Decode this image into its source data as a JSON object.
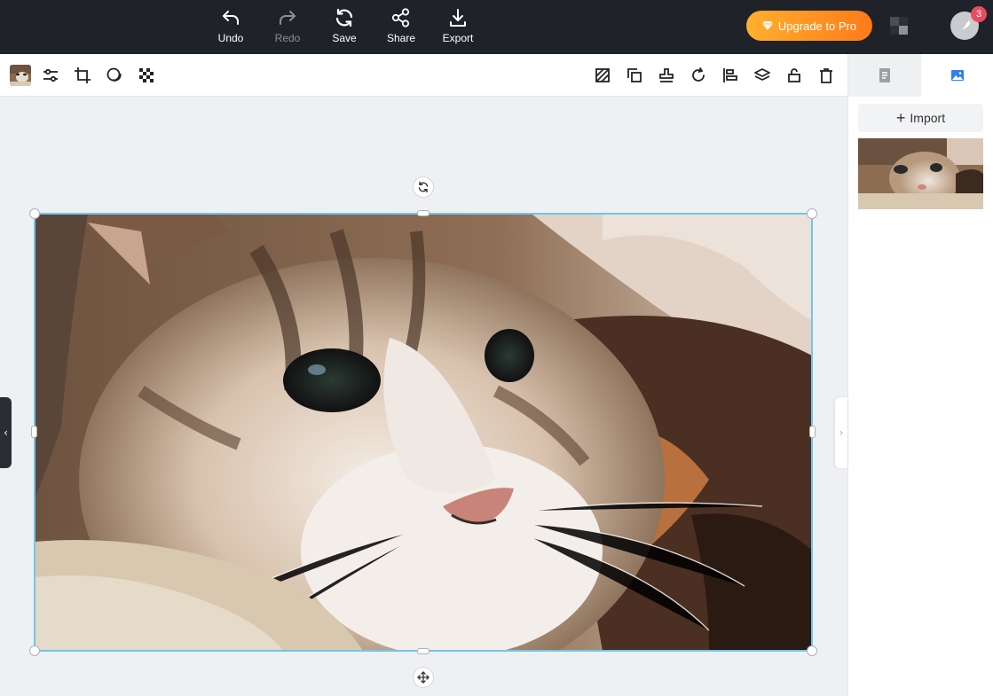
{
  "topbar": {
    "undo_label": "Undo",
    "redo_label": "Redo",
    "save_label": "Save",
    "share_label": "Share",
    "export_label": "Export",
    "upgrade_label": "Upgrade to Pro",
    "notification_count": "3"
  },
  "panel": {
    "import_label": "Import"
  },
  "colors": {
    "topbar_bg": "#1f2329",
    "accent": "#2f80ed",
    "selection": "#6cc7ef",
    "upgrade_start": "#ffb02e",
    "upgrade_end": "#ff7a1a",
    "badge": "#ea4c5f"
  },
  "icons": {
    "toolbar_left": [
      "adjust-sliders-icon",
      "crop-icon",
      "shape-mask-icon",
      "transparency-icon"
    ],
    "toolbar_right": [
      "flip-icon",
      "duplicate-icon",
      "stamp-icon",
      "rotate-icon",
      "align-icon",
      "layers-icon",
      "lock-icon",
      "delete-icon"
    ],
    "panel_tabs": [
      "text-document-icon",
      "image-icon"
    ]
  }
}
